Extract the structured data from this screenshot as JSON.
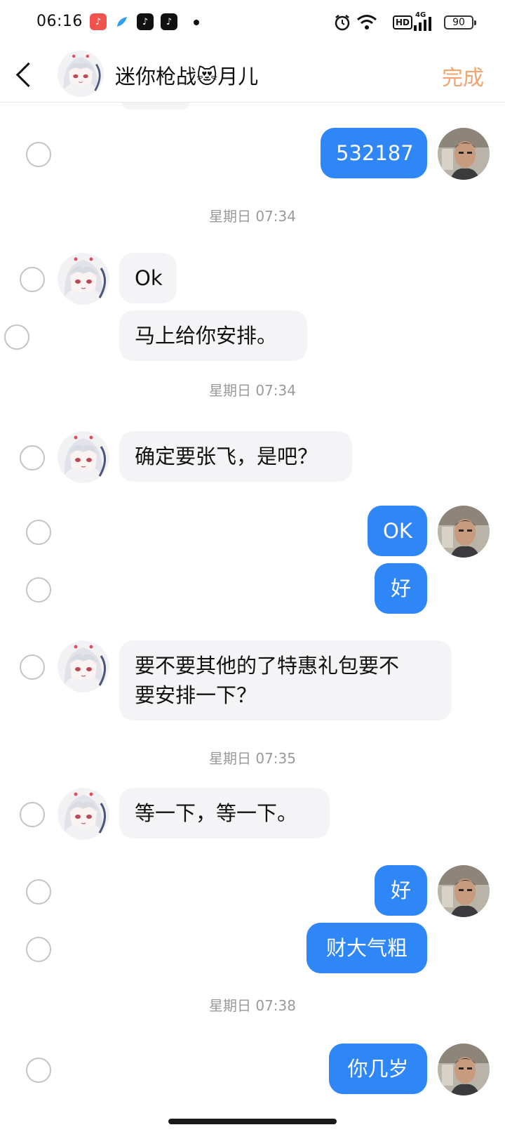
{
  "status_bar": {
    "time": "06:16",
    "battery": "90",
    "network_badge": "HD",
    "network_type": "4G",
    "icons": [
      "music-app-icon",
      "feather-app-icon",
      "tiktok-icon",
      "tiktok-live-icon",
      "alarm-icon",
      "wifi-icon",
      "signal-icon",
      "battery-icon"
    ]
  },
  "header": {
    "title": "迷你枪战😻月儿",
    "done_label": "完成"
  },
  "colors": {
    "outgoing_bubble": "#2f86f6",
    "incoming_bubble": "#f4f4f6",
    "done_accent": "#f2a56f",
    "timestamp": "#9a9a9a"
  },
  "messages": [
    {
      "text": "532187"
    },
    {
      "time": "星期日 07:34"
    },
    {
      "text": "Ok"
    },
    {
      "text": "马上给你安排。"
    },
    {
      "time": "星期日 07:34"
    },
    {
      "text": "确定要张飞，是吧？"
    },
    {
      "text": "OK"
    },
    {
      "text": "好"
    },
    {
      "text": "要不要其他的了特惠礼包要不\n要安排一下？"
    },
    {
      "time": "星期日 07:35"
    },
    {
      "text": "等一下，等一下。"
    },
    {
      "text": "好"
    },
    {
      "text": "财大气粗"
    },
    {
      "time": "星期日 07:38"
    },
    {
      "text": "你几岁"
    }
  ]
}
